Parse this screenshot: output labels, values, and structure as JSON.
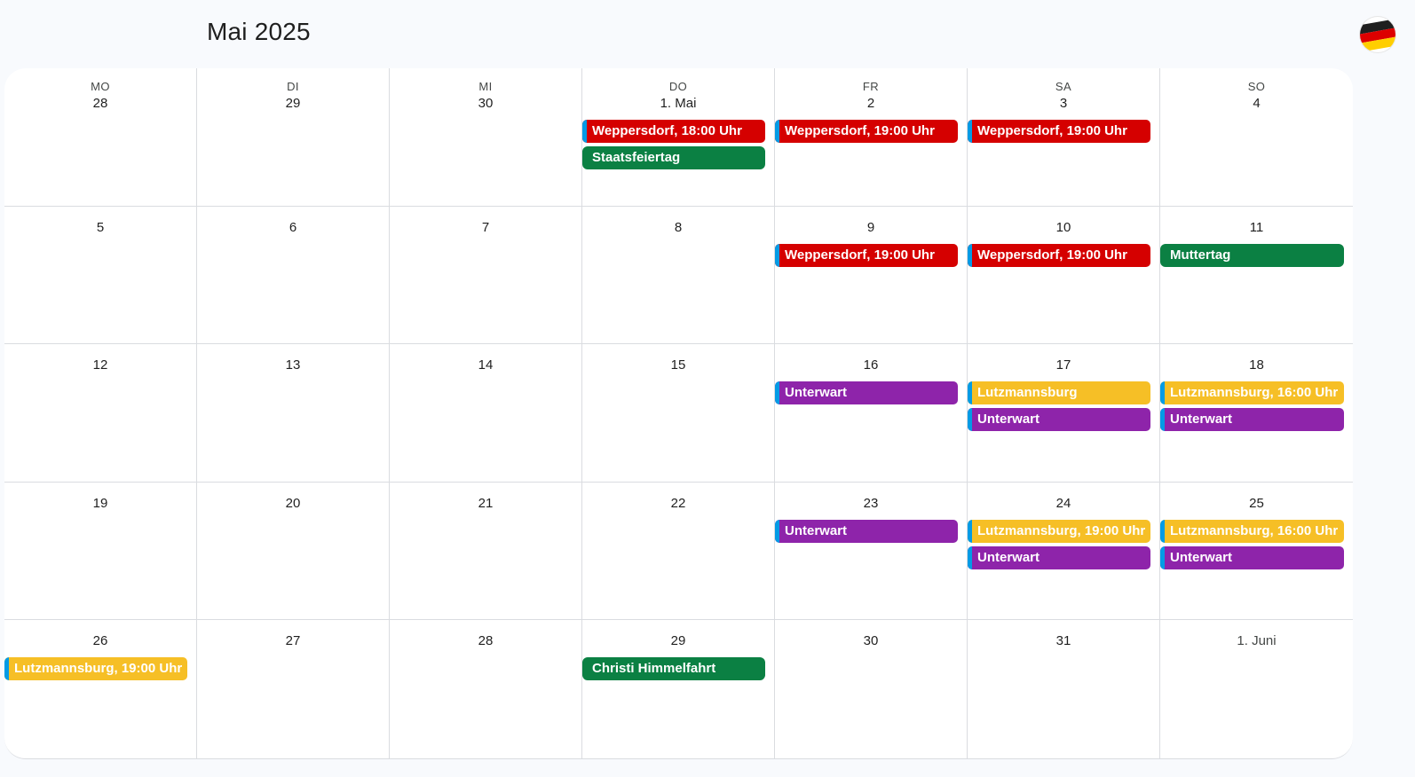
{
  "header": {
    "month_title": "Mai 2025"
  },
  "colors": {
    "red": "#d50000",
    "green": "#0b8043",
    "yellow": "#f6bf26",
    "purple": "#8e24aa",
    "edge_blue": "#039be5",
    "flag_black": "#1f1f1f",
    "flag_red": "#dd0000",
    "flag_gold": "#ffce00"
  },
  "weekdays": [
    "MO",
    "DI",
    "MI",
    "DO",
    "FR",
    "SA",
    "SO"
  ],
  "weeks": [
    [
      {
        "label": "28",
        "events": []
      },
      {
        "label": "29",
        "events": []
      },
      {
        "label": "30",
        "events": []
      },
      {
        "label": "1. Mai",
        "events": [
          {
            "title": "Weppersdorf, 18:00 Uhr",
            "color": "red",
            "edge": true
          },
          {
            "title": "Staatsfeiertag",
            "color": "green",
            "edge": false
          }
        ]
      },
      {
        "label": "2",
        "events": [
          {
            "title": "Weppersdorf, 19:00 Uhr",
            "color": "red",
            "edge": true
          }
        ]
      },
      {
        "label": "3",
        "events": [
          {
            "title": "Weppersdorf, 19:00 Uhr",
            "color": "red",
            "edge": true
          }
        ]
      },
      {
        "label": "4",
        "events": []
      }
    ],
    [
      {
        "label": "5",
        "events": []
      },
      {
        "label": "6",
        "events": []
      },
      {
        "label": "7",
        "events": []
      },
      {
        "label": "8",
        "events": []
      },
      {
        "label": "9",
        "events": [
          {
            "title": "Weppersdorf, 19:00 Uhr",
            "color": "red",
            "edge": true
          }
        ]
      },
      {
        "label": "10",
        "events": [
          {
            "title": "Weppersdorf, 19:00 Uhr",
            "color": "red",
            "edge": true
          }
        ]
      },
      {
        "label": "11",
        "events": [
          {
            "title": "Muttertag",
            "color": "green",
            "edge": false
          }
        ]
      }
    ],
    [
      {
        "label": "12",
        "events": []
      },
      {
        "label": "13",
        "events": []
      },
      {
        "label": "14",
        "events": []
      },
      {
        "label": "15",
        "events": []
      },
      {
        "label": "16",
        "events": [
          {
            "title": "Unterwart",
            "color": "purple",
            "edge": true
          }
        ]
      },
      {
        "label": "17",
        "events": [
          {
            "title": "Lutzmannsburg",
            "color": "yellow",
            "edge": true
          },
          {
            "title": "Unterwart",
            "color": "purple",
            "edge": true
          }
        ]
      },
      {
        "label": "18",
        "events": [
          {
            "title": "Lutzmannsburg, 16:00 Uhr",
            "color": "yellow",
            "edge": true
          },
          {
            "title": "Unterwart",
            "color": "purple",
            "edge": true
          }
        ]
      }
    ],
    [
      {
        "label": "19",
        "events": []
      },
      {
        "label": "20",
        "events": []
      },
      {
        "label": "21",
        "events": []
      },
      {
        "label": "22",
        "events": []
      },
      {
        "label": "23",
        "events": [
          {
            "title": "Unterwart",
            "color": "purple",
            "edge": true
          }
        ]
      },
      {
        "label": "24",
        "events": [
          {
            "title": "Lutzmannsburg, 19:00 Uhr",
            "color": "yellow",
            "edge": true
          },
          {
            "title": "Unterwart",
            "color": "purple",
            "edge": true
          }
        ]
      },
      {
        "label": "25",
        "events": [
          {
            "title": "Lutzmannsburg, 16:00 Uhr",
            "color": "yellow",
            "edge": true
          },
          {
            "title": "Unterwart",
            "color": "purple",
            "edge": true
          }
        ]
      }
    ],
    [
      {
        "label": "26",
        "events": [
          {
            "title": "Lutzmannsburg, 19:00 Uhr",
            "color": "yellow",
            "edge": true
          }
        ]
      },
      {
        "label": "27",
        "events": []
      },
      {
        "label": "28",
        "events": []
      },
      {
        "label": "29",
        "events": [
          {
            "title": "Christi Himmelfahrt",
            "color": "green",
            "edge": false
          }
        ]
      },
      {
        "label": "30",
        "events": []
      },
      {
        "label": "31",
        "events": []
      },
      {
        "label": "1. Juni",
        "muted": true,
        "events": []
      }
    ]
  ]
}
